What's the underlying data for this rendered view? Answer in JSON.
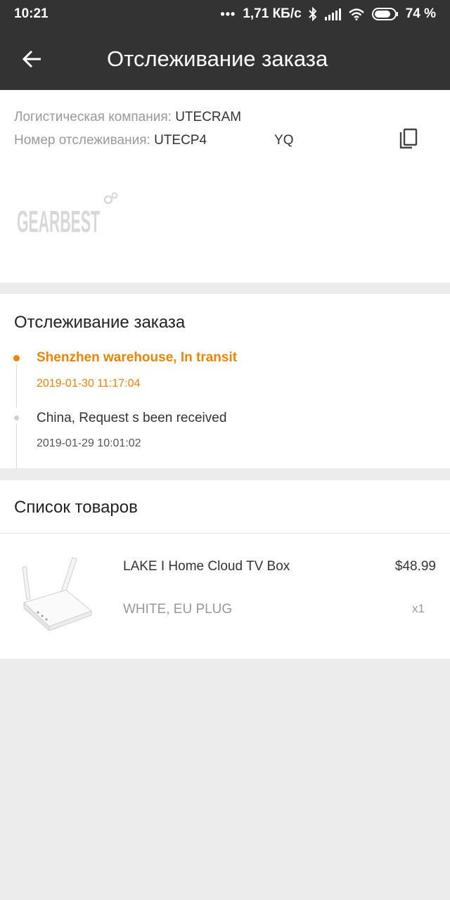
{
  "status_bar": {
    "time": "10:21",
    "dots": "•••",
    "network_speed": "1,71 КБ/с",
    "battery": "74 %"
  },
  "toolbar": {
    "title": "Отслеживание заказа"
  },
  "logistics": {
    "company_label": "Логистическая компания: ",
    "company_value": "UTECRAM",
    "tracking_label": "Номер отслеживания: ",
    "tracking_value_start": "UTECP4",
    "tracking_value_end": "YQ",
    "logo_text": "GEARBEST"
  },
  "tracking": {
    "title": "Отслеживание заказа",
    "events": [
      {
        "title": "Shenzhen warehouse, In transit",
        "time": "2019-01-30 11:17:04"
      },
      {
        "title": "China, Request s been received",
        "time": "2019-01-29 10:01:02"
      }
    ]
  },
  "products": {
    "title": "Список товаров",
    "items": [
      {
        "name": "LAKE I Home Cloud TV Box",
        "price": "$48.99",
        "variant": "WHITE, EU PLUG",
        "quantity": "x1"
      }
    ]
  },
  "colors": {
    "toolbar_bg": "#333333",
    "accent_orange": "#f08300",
    "page_bg": "#ececec"
  }
}
